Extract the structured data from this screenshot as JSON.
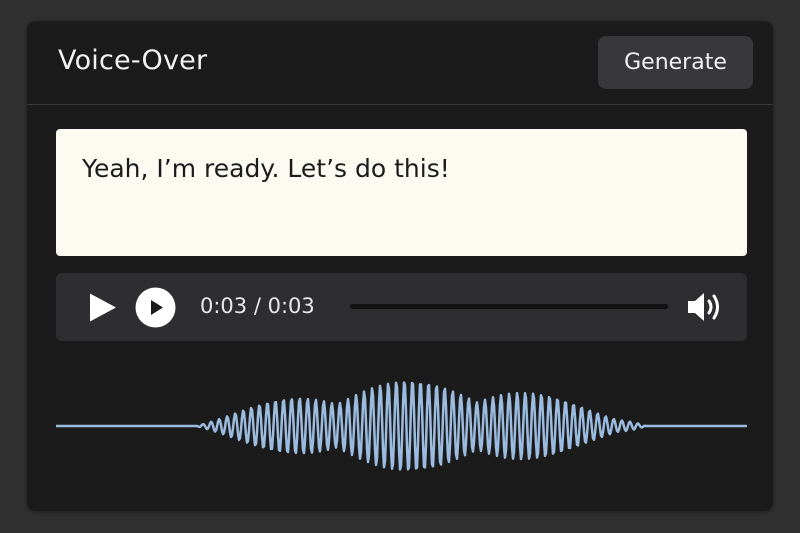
{
  "header": {
    "title": "Voice-Over",
    "generate_label": "Generate"
  },
  "script": {
    "text": "Yeah, I’m ready. Let’s do this!"
  },
  "player": {
    "time_display": "0:03 / 0:03",
    "progress": 1.0,
    "icons": [
      "play-icon",
      "play-circle-icon",
      "volume-icon"
    ]
  },
  "colors": {
    "background": "#2f2f30",
    "panel": "#1b1b1c",
    "button": "#38383a",
    "text_box": "#fcfbf2",
    "player_bar": "#2e2e30",
    "waveform": "#9bbbdf"
  }
}
